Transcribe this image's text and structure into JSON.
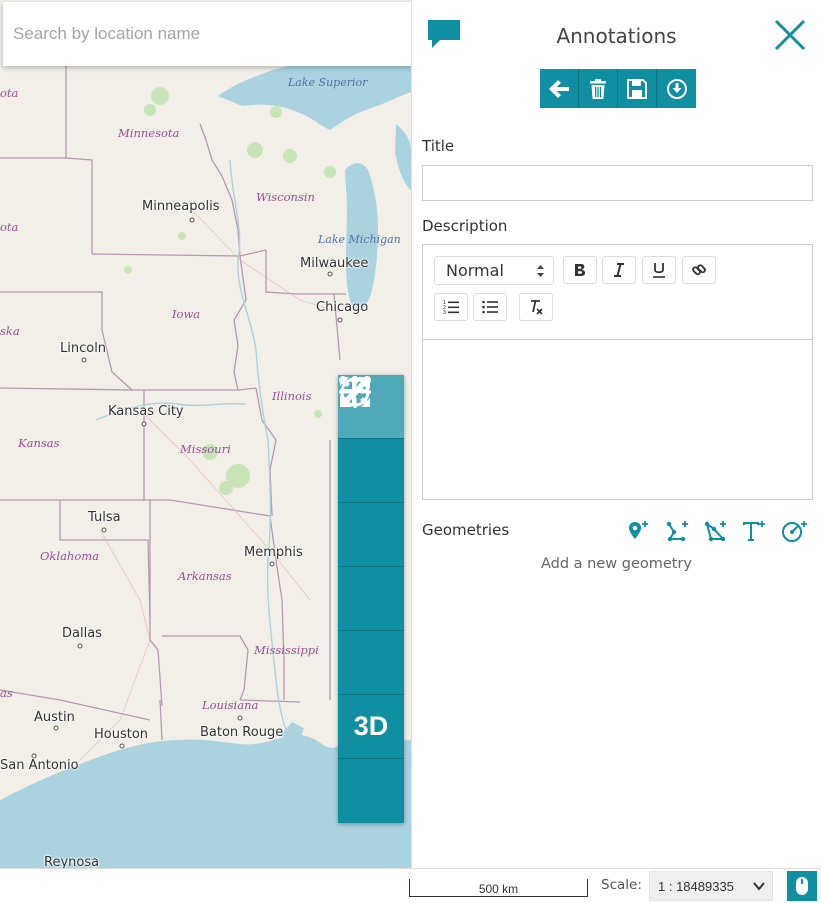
{
  "search": {
    "placeholder": "Search by location name"
  },
  "map": {
    "cities": [
      {
        "name": "Minneapolis"
      },
      {
        "name": "Milwaukee"
      },
      {
        "name": "Chicago"
      },
      {
        "name": "Lincoln"
      },
      {
        "name": "Kansas City"
      },
      {
        "name": "Tulsa"
      },
      {
        "name": "Memphis"
      },
      {
        "name": "Dallas"
      },
      {
        "name": "Austin"
      },
      {
        "name": "Houston"
      },
      {
        "name": "Baton Rouge"
      },
      {
        "name": "San Antonio"
      },
      {
        "name": "Reynosa"
      }
    ],
    "states": [
      {
        "name": "ota"
      },
      {
        "name": "Minnesota"
      },
      {
        "name": "Wisconsin"
      },
      {
        "name": "ota"
      },
      {
        "name": "Iowa"
      },
      {
        "name": "ska"
      },
      {
        "name": "Illinois"
      },
      {
        "name": "Kansas"
      },
      {
        "name": "Missouri"
      },
      {
        "name": "Oklahoma"
      },
      {
        "name": "Arkansas"
      },
      {
        "name": "Mississippi"
      },
      {
        "name": "Louisiana"
      },
      {
        "name": "as"
      }
    ],
    "water": [
      {
        "name": "Lake Superior"
      },
      {
        "name": "Lake Michigan"
      }
    ],
    "tools": [
      {
        "icon": "locate-icon"
      },
      {
        "icon": "zoom-in-icon"
      },
      {
        "icon": "zoom-out-icon"
      },
      {
        "icon": "zoom-to-extent-icon"
      },
      {
        "icon": "fullscreen-icon"
      },
      {
        "label": "3D"
      },
      {
        "icon": "more-icon"
      }
    ]
  },
  "panel": {
    "title": "Annotations",
    "actions": [
      "back-arrow-icon",
      "trash-icon",
      "save-icon",
      "download-icon"
    ],
    "title_label": "Title",
    "title_value": "",
    "description_label": "Description",
    "editor": {
      "heading": "Normal",
      "body": ""
    },
    "geometries_label": "Geometries",
    "geometries_empty": "Add a new geometry"
  },
  "footer": {
    "scalebar": "500 km",
    "scale_label": "Scale:",
    "scale_value": "1 : 18489335"
  },
  "colors": {
    "accent": "#0f8fa1",
    "accent_dark": "#0a7483",
    "map_land": "#f2efe9",
    "map_water": "#aad3df",
    "border_purple": "#b699b2"
  }
}
